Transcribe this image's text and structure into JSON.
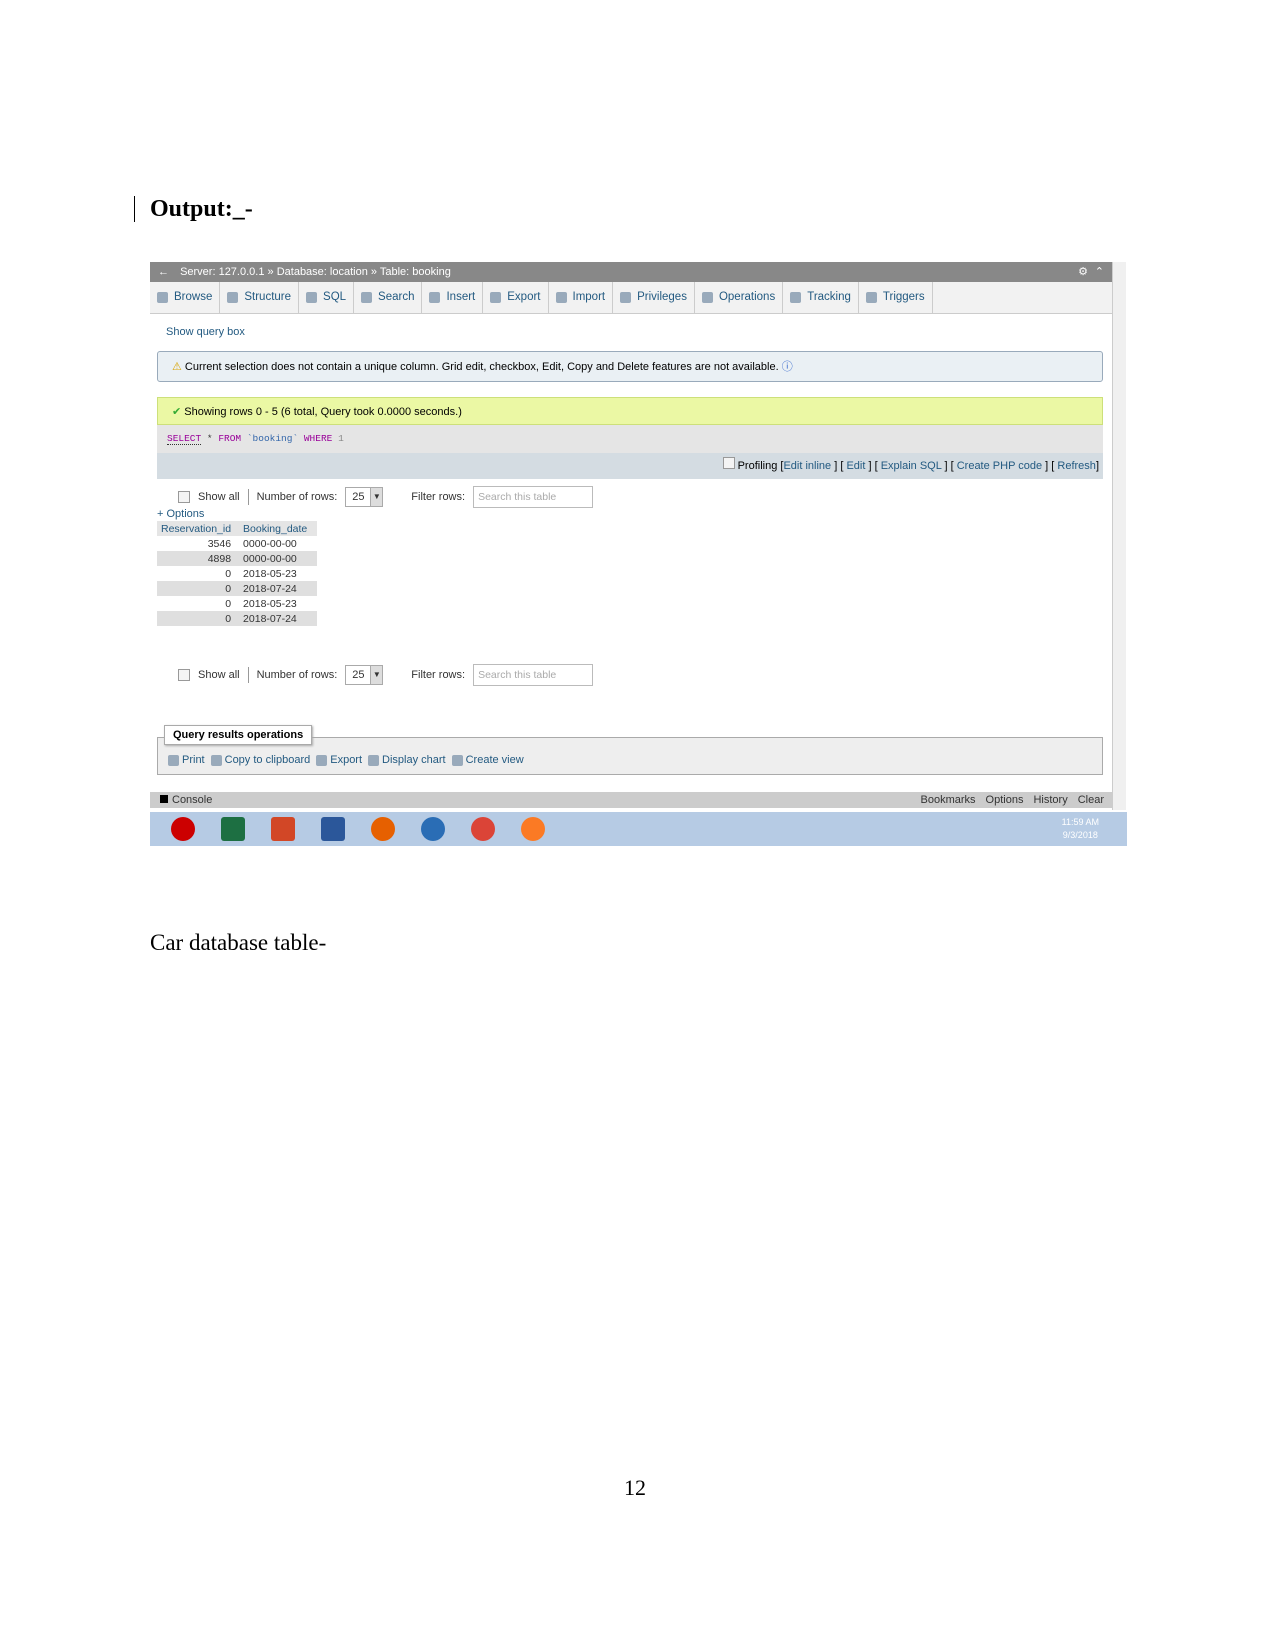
{
  "doc": {
    "heading": "Output:_-",
    "caption": "Car database table-",
    "page_number": "12"
  },
  "pma": {
    "breadcrumb": {
      "server": "Server: 127.0.0.1",
      "database": "Database: location",
      "table": "Table: booking",
      "sep": "»"
    },
    "tabs": [
      "Browse",
      "Structure",
      "SQL",
      "Search",
      "Insert",
      "Export",
      "Import",
      "Privileges",
      "Operations",
      "Tracking",
      "Triggers"
    ],
    "show_query_box": "Show query box",
    "warning": "Current selection does not contain a unique column. Grid edit, checkbox, Edit, Copy and Delete features are not available.",
    "success": "Showing rows 0 - 5 (6 total, Query took 0.0000 seconds.)",
    "sql": {
      "k1": "SELECT",
      "star": " * ",
      "k2": "FROM",
      "tbl": " `booking` ",
      "k3": "WHERE",
      "one": " 1"
    },
    "profiling": {
      "label": "Profiling",
      "links": [
        "Edit inline",
        "Edit",
        "Explain SQL",
        "Create PHP code",
        "Refresh"
      ]
    },
    "controls": {
      "show_all": "Show all",
      "rows_label": "Number of rows:",
      "rows_value": "25",
      "filter_label": "Filter rows:",
      "filter_placeholder": "Search this table"
    },
    "options": "+ Options",
    "columns": [
      "Reservation_id",
      "Booking_date"
    ],
    "rows": [
      [
        "3546",
        "0000-00-00"
      ],
      [
        "4898",
        "0000-00-00"
      ],
      [
        "0",
        "2018-05-23"
      ],
      [
        "0",
        "2018-07-24"
      ],
      [
        "0",
        "2018-05-23"
      ],
      [
        "0",
        "2018-07-24"
      ]
    ],
    "ops_legend": "Query results operations",
    "ops": [
      "Print",
      "Copy to clipboard",
      "Export",
      "Display chart",
      "Create view"
    ],
    "console": {
      "label": "Console",
      "right": [
        "Bookmarks",
        "Options",
        "History",
        "Clear"
      ]
    },
    "taskbar": {
      "apps": [
        "opera-icon",
        "excel-icon",
        "powerpoint-icon",
        "word-icon",
        "firefox-icon",
        "thunderbird-icon",
        "chrome-icon",
        "xampp-icon"
      ],
      "time": "11:59 AM",
      "date": "9/3/2018"
    }
  }
}
